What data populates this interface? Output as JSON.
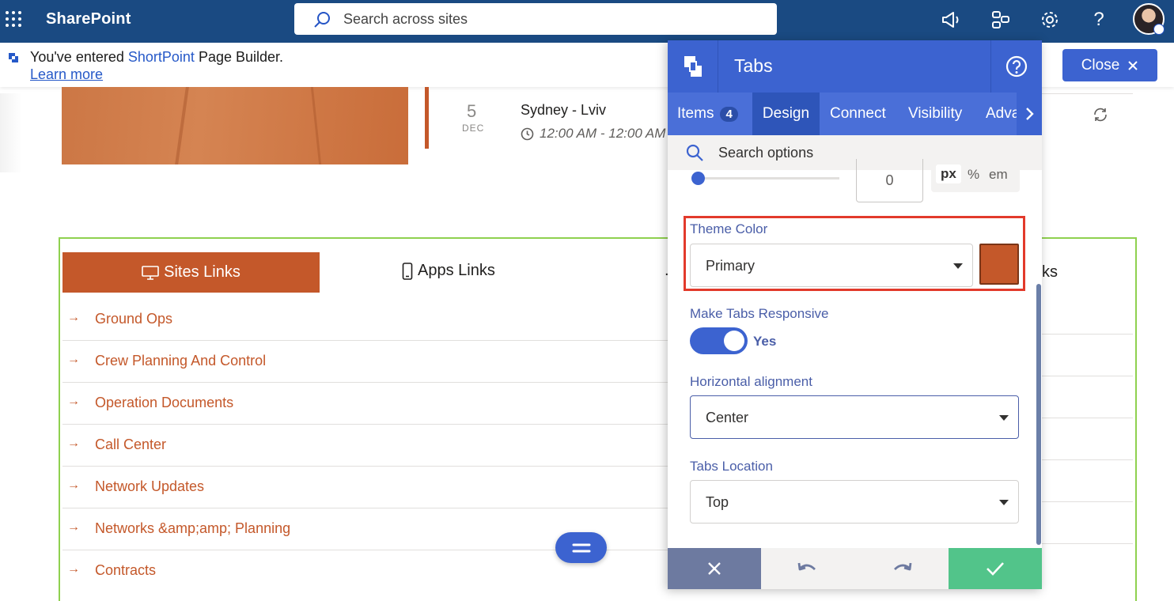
{
  "topbar": {
    "brand": "SharePoint",
    "search_placeholder": "Search across sites"
  },
  "notice": {
    "prefix": "You've entered ",
    "product": "ShortPoint",
    "suffix": " Page Builder.",
    "learn_more": "Learn more",
    "close_label": "Close"
  },
  "event": {
    "day": "5",
    "month": "DEC",
    "title": "Sydney - Lviv",
    "time": "12:00 AM - 12:00 AM"
  },
  "tabs_section": {
    "tabs": [
      {
        "label": "Sites Links"
      },
      {
        "label": "Apps Links"
      },
      {
        "label": "."
      },
      {
        "label": "ks"
      }
    ],
    "links": [
      "Ground Ops",
      "Crew Planning And Control",
      "Operation Documents",
      "Call Center",
      "Network Updates",
      "Networks &amp;amp; Planning",
      "Contracts"
    ],
    "arrow_glyph": "→"
  },
  "panel": {
    "title": "Tabs",
    "tabs": [
      {
        "label": "Items",
        "count": "4"
      },
      {
        "label": "Design"
      },
      {
        "label": "Connect"
      },
      {
        "label": "Visibility"
      },
      {
        "label": "Adva"
      }
    ],
    "search_placeholder": "Search options",
    "number_value": "0",
    "units": [
      "px",
      "%",
      "em"
    ],
    "theme_color": {
      "label": "Theme Color",
      "value": "Primary",
      "swatch": "#c4582a"
    },
    "responsive": {
      "label": "Make Tabs Responsive",
      "value": "Yes"
    },
    "halign": {
      "label": "Horizontal alignment",
      "value": "Center"
    },
    "location": {
      "label": "Tabs Location",
      "value": "Top"
    }
  },
  "colors": {
    "sharepoint_bar": "#1a4a82",
    "accent": "#3c63d0",
    "theme": "#c4582a",
    "confirm": "#52c48a"
  }
}
